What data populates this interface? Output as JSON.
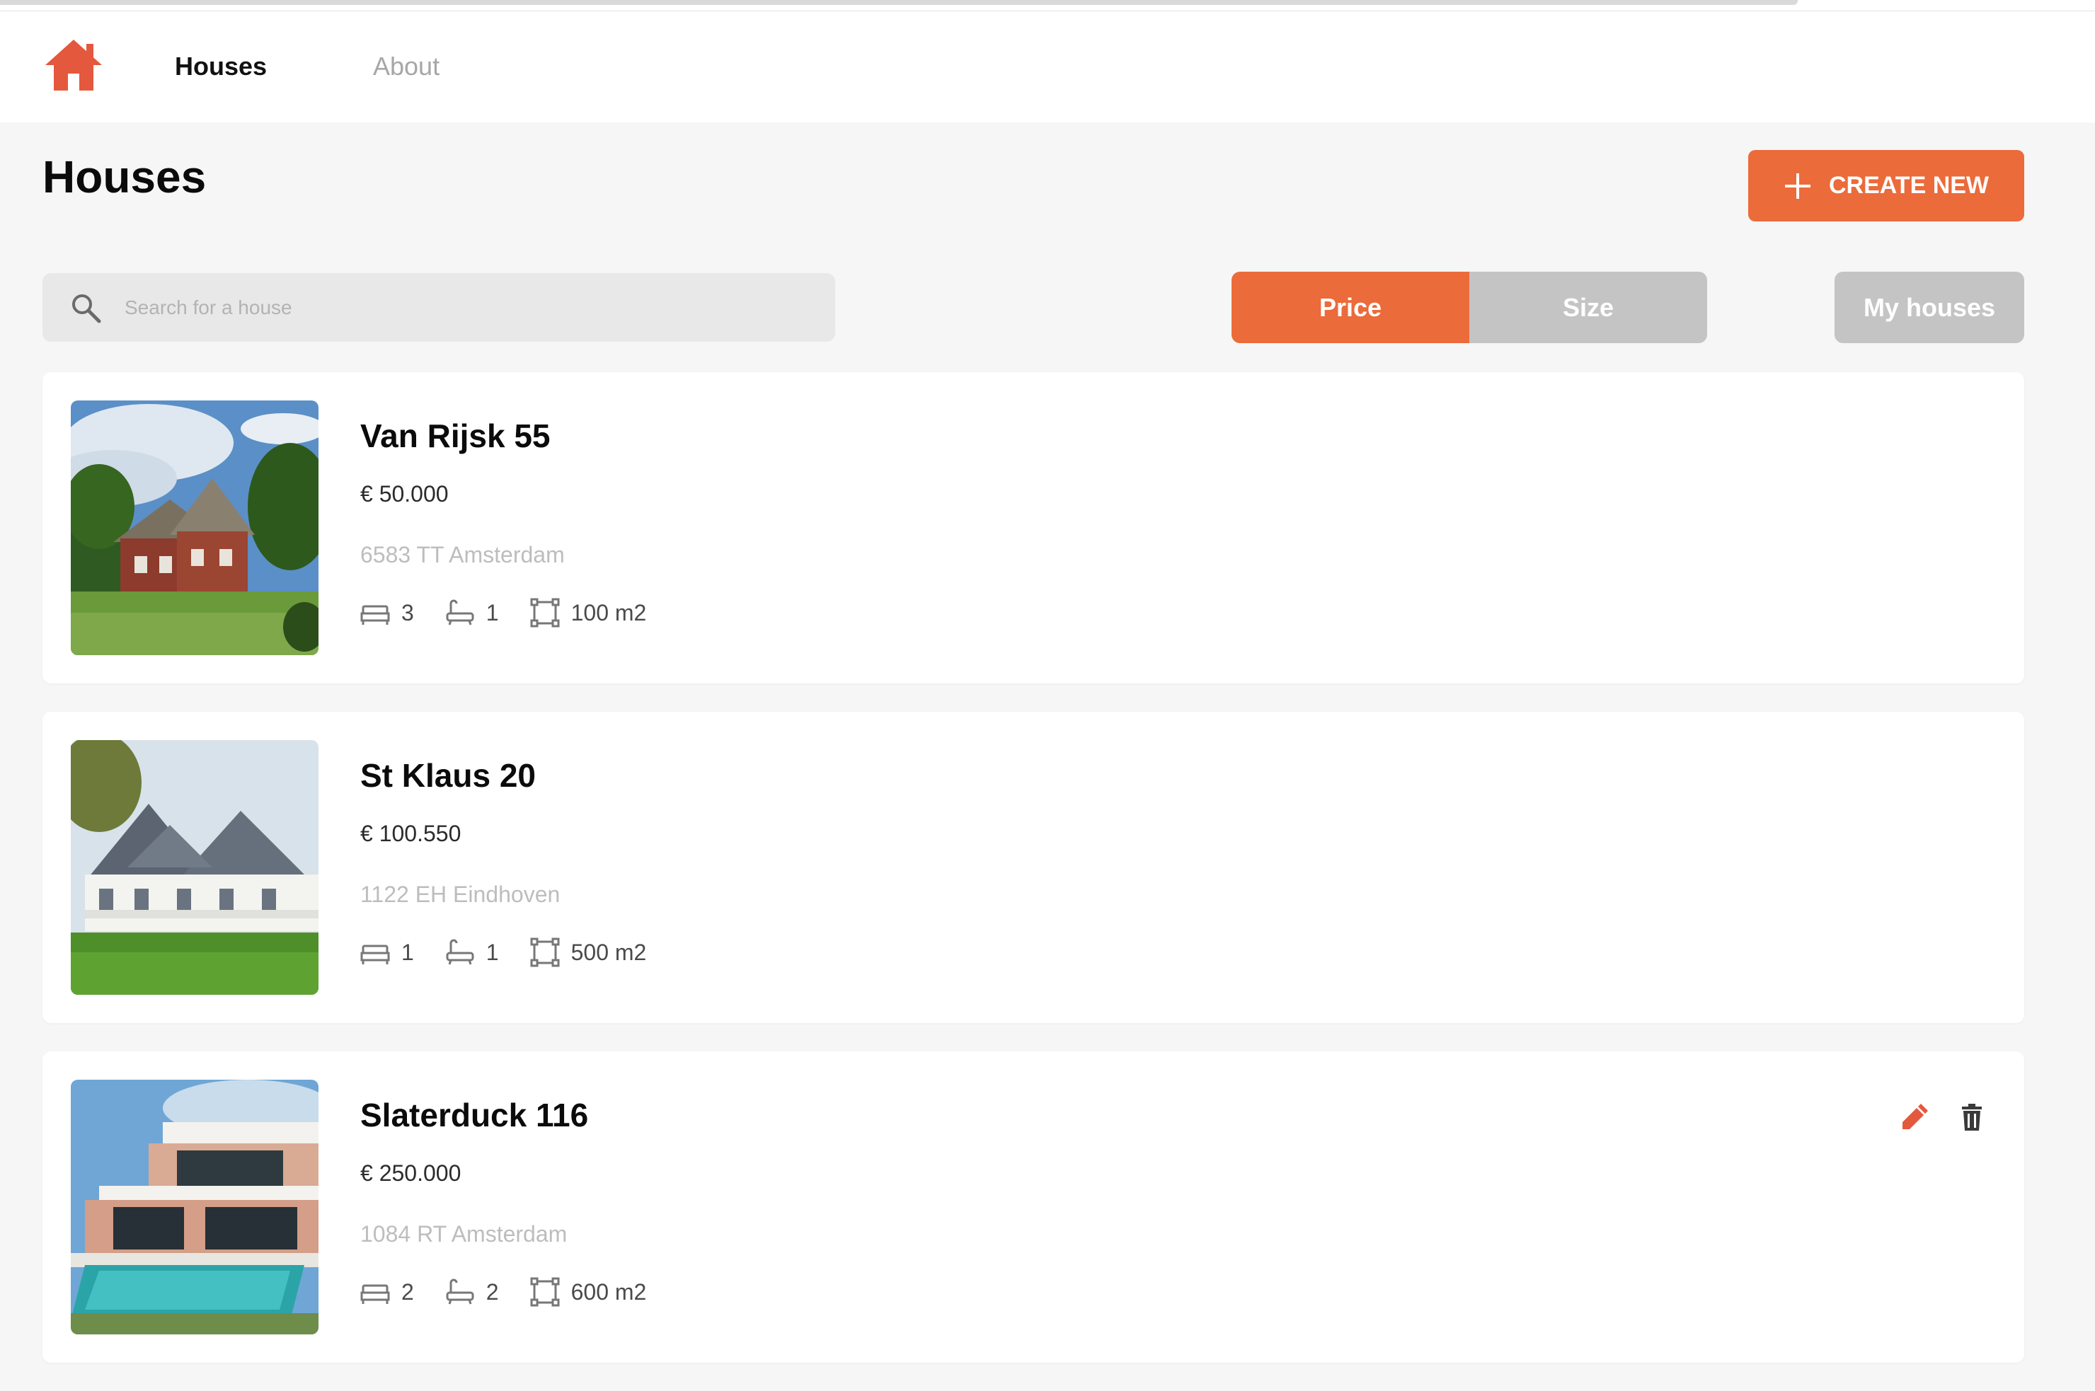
{
  "nav": {
    "houses_label": "Houses",
    "about_label": "About"
  },
  "header": {
    "title": "Houses",
    "create_label": "CREATE NEW"
  },
  "search": {
    "placeholder": "Search for a house",
    "value": ""
  },
  "sort": {
    "price_label": "Price",
    "size_label": "Size",
    "active": "Price"
  },
  "filter": {
    "my_houses_label": "My houses"
  },
  "listings": [
    {
      "street": "Van Rijsk 55",
      "price": "€ 50.000",
      "location": "6583 TT Amsterdam",
      "bedrooms": "3",
      "bathrooms": "1",
      "size": "100 m2",
      "editable": false
    },
    {
      "street": "St Klaus 20",
      "price": "€ 100.550",
      "location": "1122 EH Eindhoven",
      "bedrooms": "1",
      "bathrooms": "1",
      "size": "500 m2",
      "editable": false
    },
    {
      "street": "Slaterduck 116",
      "price": "€ 250.000",
      "location": "1084 RT Amsterdam",
      "bedrooms": "2",
      "bathrooms": "2",
      "size": "600 m2",
      "editable": true
    }
  ],
  "icons": {
    "logo": "home-icon",
    "search": "search-icon",
    "create": "plus-icon",
    "bed": "bed-icon",
    "bath": "bath-icon",
    "size": "size-icon",
    "edit": "pencil-icon",
    "delete": "trash-icon"
  },
  "colors": {
    "accent": "#eb6b3a",
    "edit_icon": "#e4583e",
    "inactive_button": "#c4c4c4",
    "background": "#f6f6f6"
  }
}
